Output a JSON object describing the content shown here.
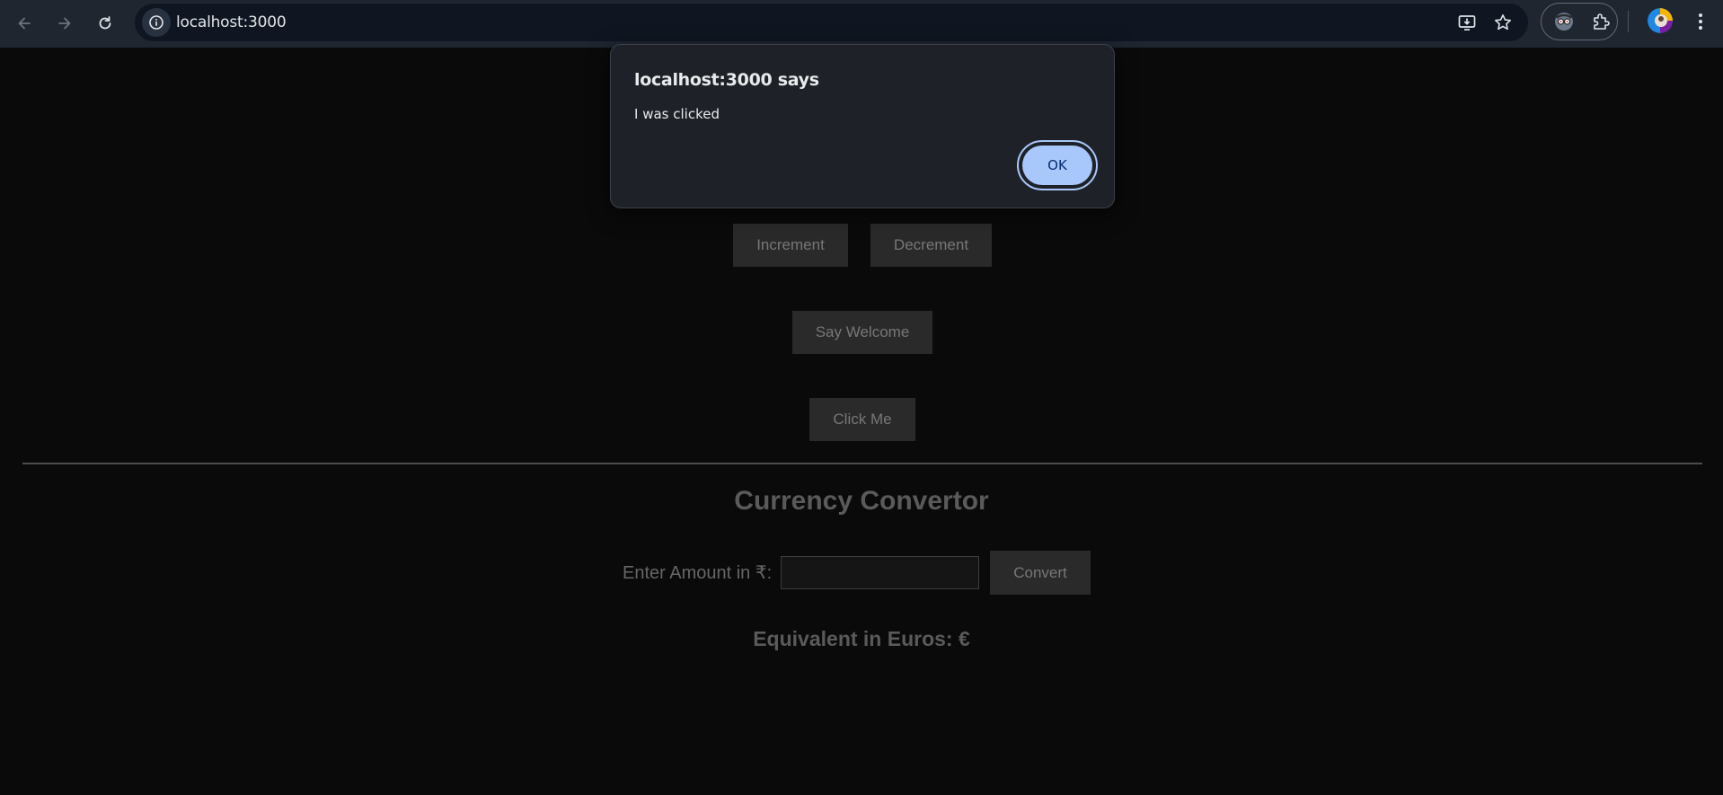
{
  "browser": {
    "url": "localhost:3000",
    "icons": [
      "back-icon",
      "forward-icon",
      "reload-icon",
      "site-info-icon",
      "install-app-icon",
      "bookmark-star-icon",
      "extension-avatar-icon",
      "extensions-puzzle-icon",
      "profile-avatar-icon",
      "more-menu-icon"
    ]
  },
  "page": {
    "buttons": {
      "increment": "Increment",
      "decrement": "Decrement",
      "say_welcome": "Say Welcome",
      "click_me": "Click Me"
    },
    "currency": {
      "title": "Currency Convertor",
      "amount_label": "Enter Amount in ₹:",
      "amount_value": "",
      "convert_label": "Convert",
      "result_text": "Equivalent in Euros: €"
    }
  },
  "dialog": {
    "title": "localhost:3000 says",
    "message": "I was clicked",
    "ok_label": "OK"
  },
  "colors": {
    "page_background": "#0a0a0a",
    "toolbar": "#1f2630",
    "dialog_background": "#1e2228",
    "ok_button": "#a8c7fa"
  }
}
